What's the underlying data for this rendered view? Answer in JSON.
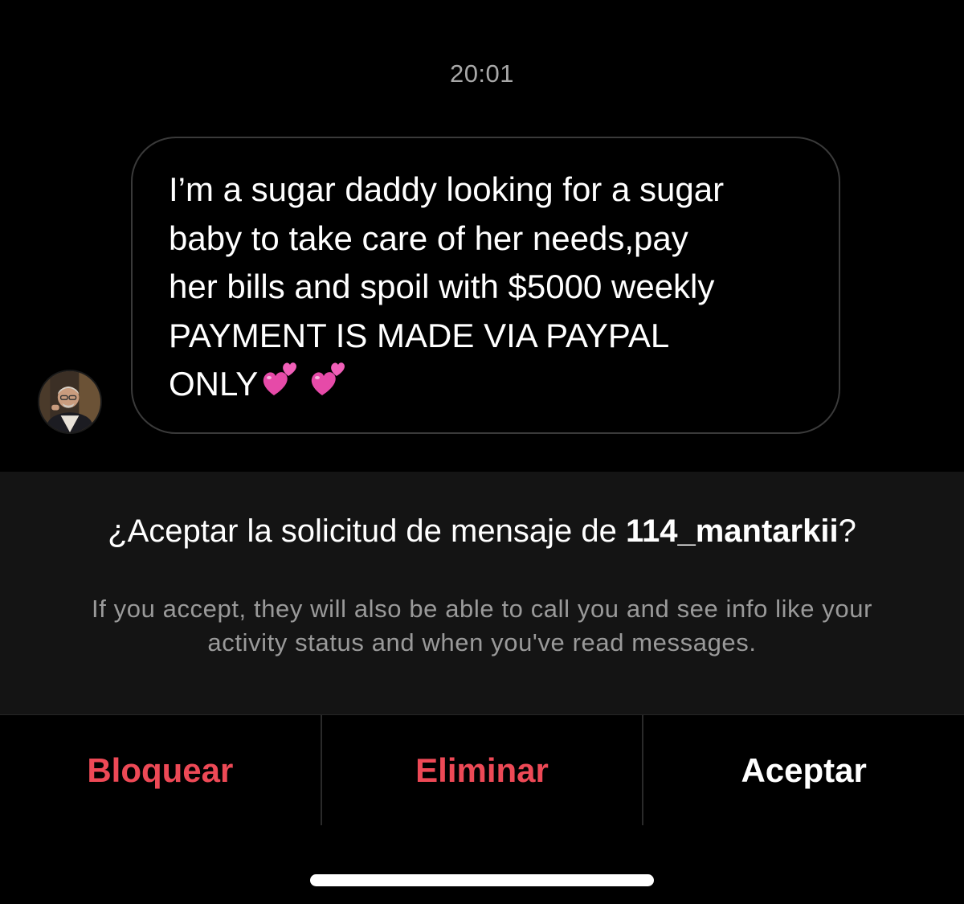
{
  "thread": {
    "timestamp": "20:01",
    "message": {
      "text": "I’m a sugar daddy looking for a sugar\nbaby to take care of her needs,pay\nher bills and spoil with $5000 weekly\nPAYMENT IS MADE VIA PAYPAL\nONLY",
      "emojis": [
        "two-hearts-icon",
        "two-hearts-icon"
      ]
    },
    "sender_avatar": "avatar"
  },
  "request": {
    "title_prefix": "¿Aceptar la solicitud de mensaje de ",
    "username": "114_mantarkii",
    "title_suffix": "?",
    "description": "If you accept, they will also be able to call you and see info like your activity status and when you've read messages."
  },
  "actions": {
    "block_label": "Bloquear",
    "delete_label": "Eliminar",
    "accept_label": "Aceptar"
  },
  "colors": {
    "background": "#000000",
    "panel": "#141414",
    "danger": "#ed4956",
    "secondary_text": "#9a9a9a",
    "bubble_border": "#3a3a3a"
  }
}
